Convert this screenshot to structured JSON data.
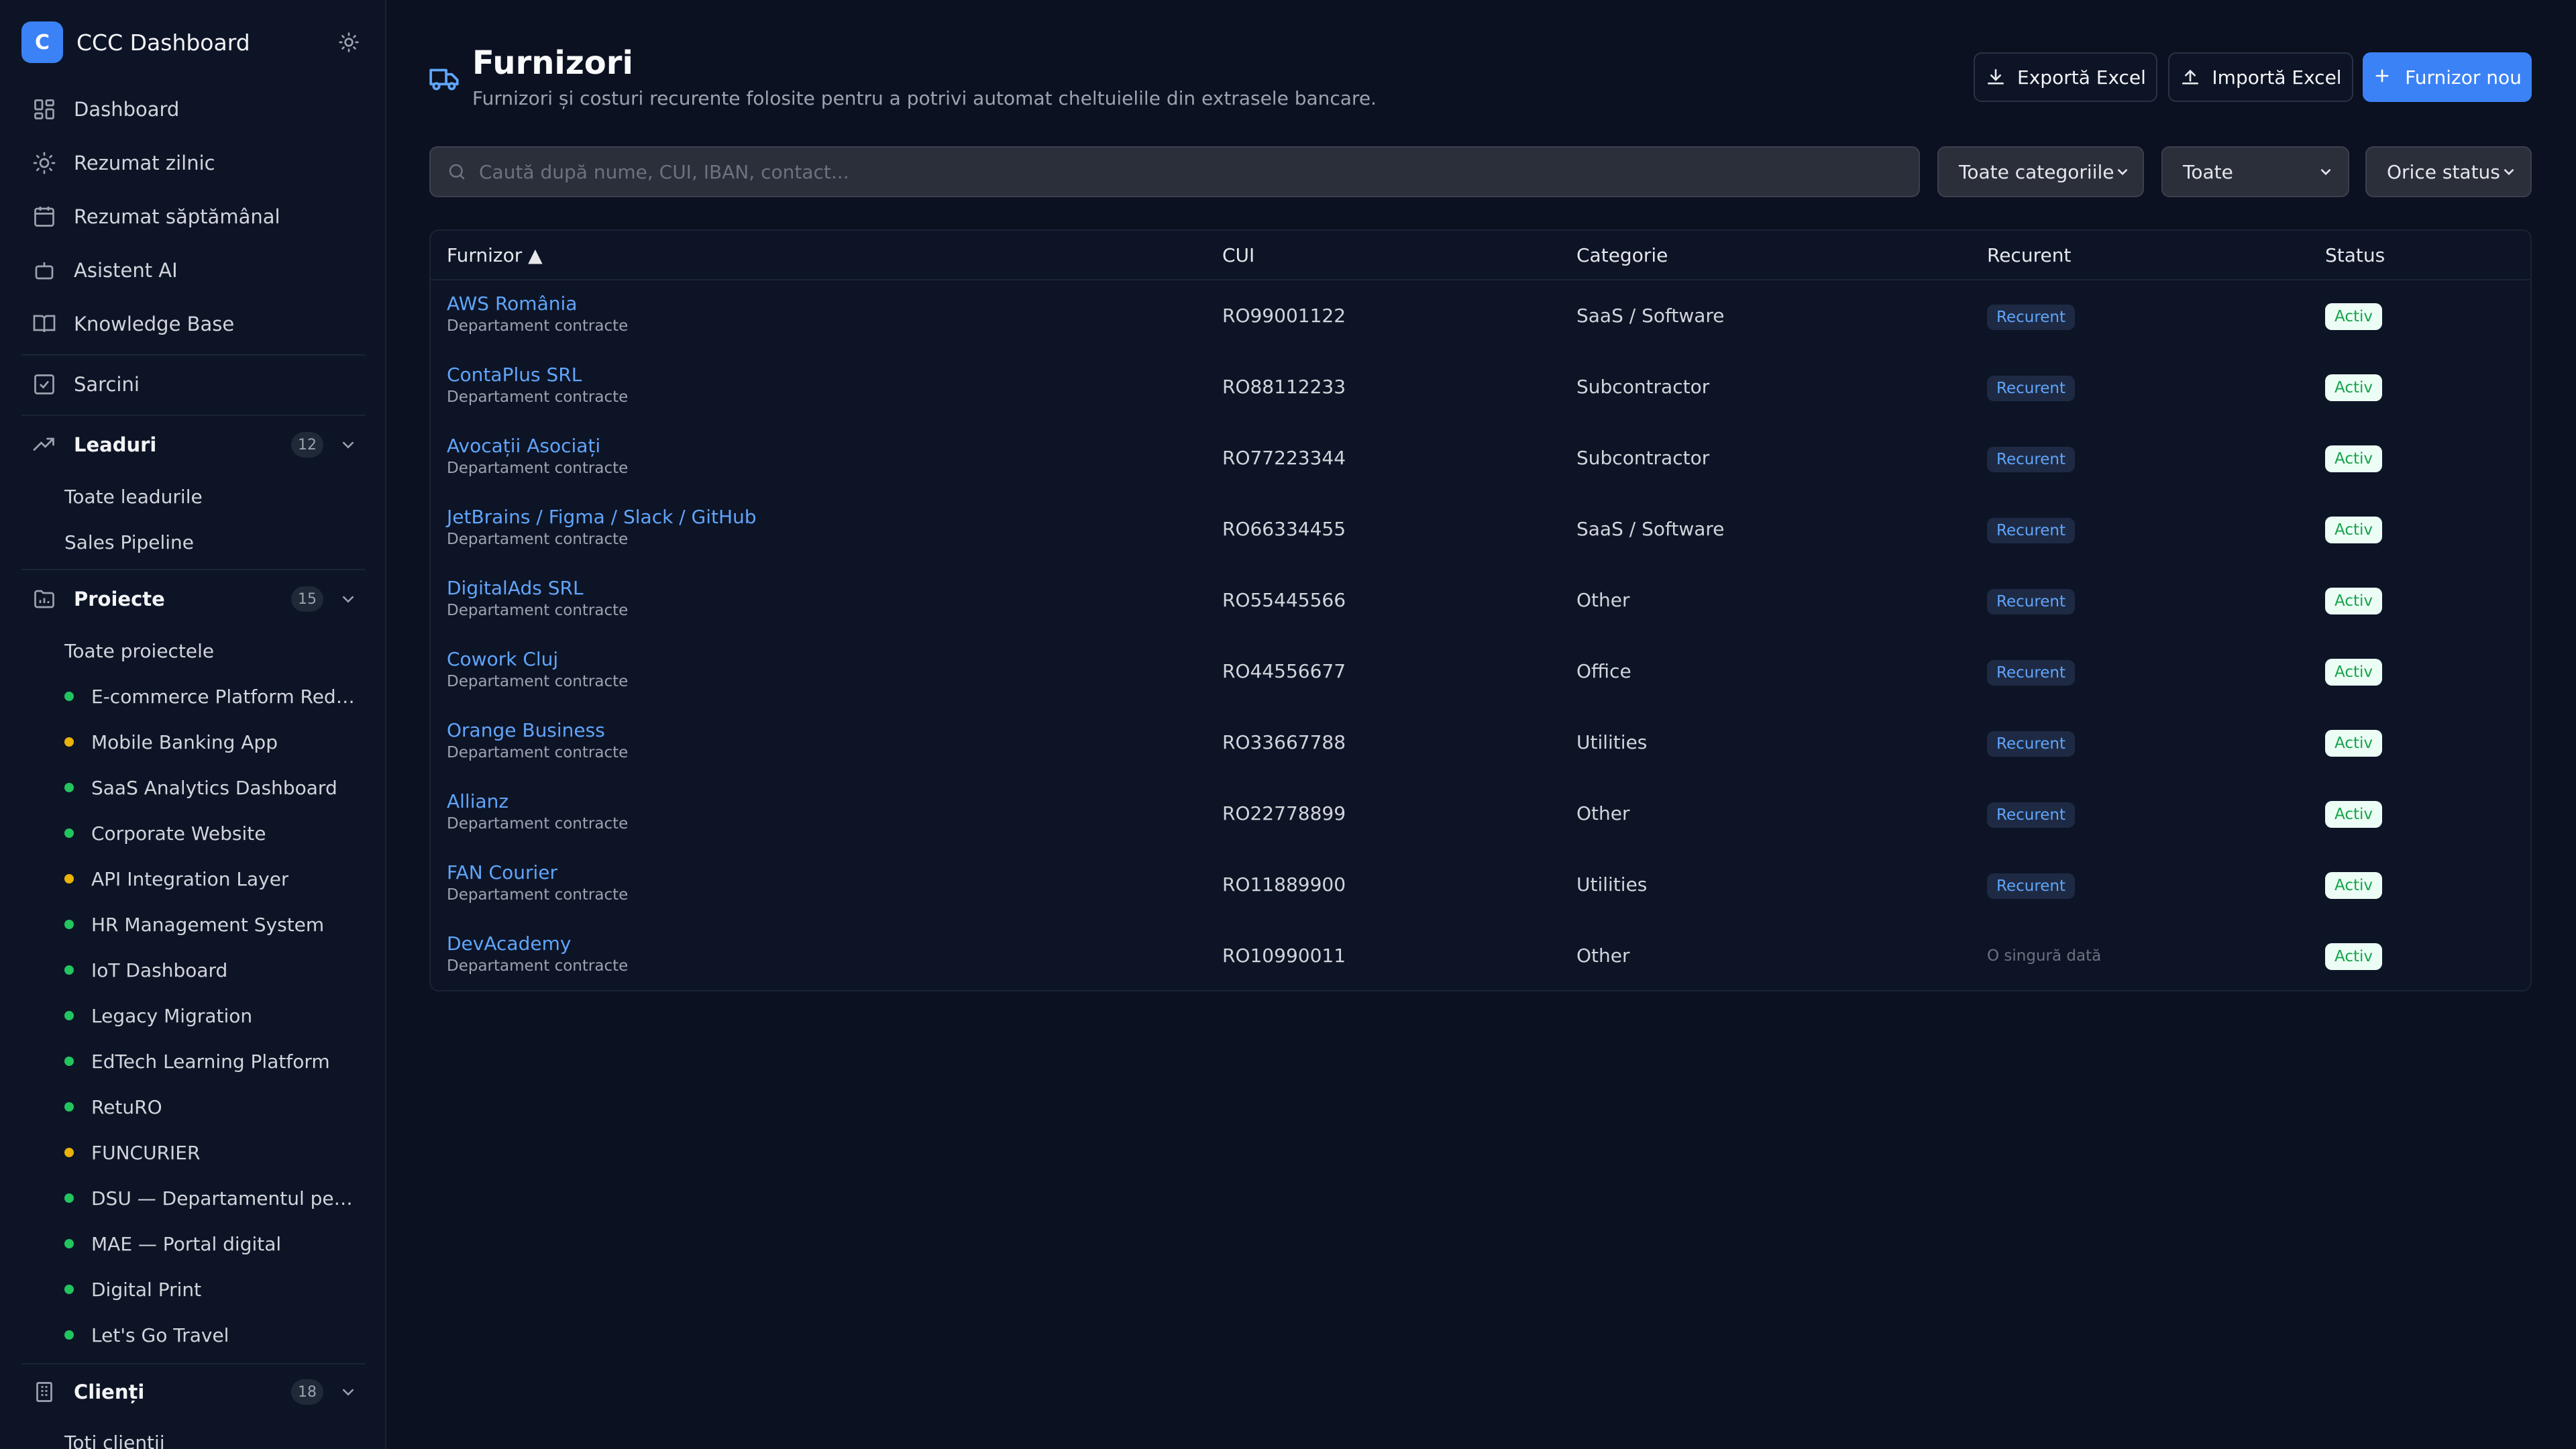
{
  "colors": {
    "accent": "#3b82f6",
    "link": "#60a5fa",
    "dot_green": "#22c55e",
    "dot_yellow": "#eab308",
    "active_badge_bg": "#ecfdf5",
    "active_badge_text": "#16a34a"
  },
  "brand": {
    "logo_letter": "C",
    "title": "CCC Dashboard",
    "theme_icon": "sun-icon"
  },
  "nav": {
    "dashboard": "Dashboard",
    "daily": "Rezumat zilnic",
    "weekly": "Rezumat săptămânal",
    "ai": "Asistent AI",
    "kb": "Knowledge Base",
    "tasks": "Sarcini",
    "leads": {
      "label": "Leaduri",
      "count": "12",
      "items": [
        "Toate leadurile",
        "Sales Pipeline"
      ]
    },
    "projects": {
      "label": "Proiecte",
      "count": "15",
      "all": "Toate proiectele",
      "items": [
        {
          "name": "E-commerce Platform Rede...",
          "status": "green"
        },
        {
          "name": "Mobile Banking App",
          "status": "yellow"
        },
        {
          "name": "SaaS Analytics Dashboard",
          "status": "green"
        },
        {
          "name": "Corporate Website",
          "status": "green"
        },
        {
          "name": "API Integration Layer",
          "status": "yellow"
        },
        {
          "name": "HR Management System",
          "status": "green"
        },
        {
          "name": "IoT Dashboard",
          "status": "green"
        },
        {
          "name": "Legacy Migration",
          "status": "green"
        },
        {
          "name": "EdTech Learning Platform",
          "status": "green"
        },
        {
          "name": "RetuRO",
          "status": "green"
        },
        {
          "name": "FUNCURIER",
          "status": "yellow"
        },
        {
          "name": "DSU — Departamentul pent...",
          "status": "green"
        },
        {
          "name": "MAE — Portal digital",
          "status": "green"
        },
        {
          "name": "Digital Print",
          "status": "green"
        },
        {
          "name": "Let's Go Travel",
          "status": "green"
        }
      ]
    },
    "clients": {
      "label": "Clienți",
      "count": "18",
      "items": [
        "Toți clienții"
      ]
    }
  },
  "page": {
    "title": "Furnizori",
    "subtitle": "Furnizori și costuri recurente folosite pentru a potrivi automat cheltuielile din extrasele bancare."
  },
  "toolbar": {
    "export": "Exportă Excel",
    "import": "Importă Excel",
    "new": "Furnizor nou"
  },
  "filters": {
    "search_placeholder": "Caută după nume, CUI, IBAN, contact...",
    "category": "Toate categoriile",
    "recurring": "Toate",
    "status": "Orice status"
  },
  "table": {
    "headers": {
      "supplier": "Furnizor ▲",
      "cui": "CUI",
      "category": "Categorie",
      "recurring": "Recurent",
      "status": "Status"
    },
    "rows": [
      {
        "name": "AWS România",
        "dept": "Departament contracte",
        "cui": "RO99001122",
        "category": "SaaS / Software",
        "recurring": "Recurent",
        "recurring_flag": true,
        "status": "Activ"
      },
      {
        "name": "ContaPlus SRL",
        "dept": "Departament contracte",
        "cui": "RO88112233",
        "category": "Subcontractor",
        "recurring": "Recurent",
        "recurring_flag": true,
        "status": "Activ"
      },
      {
        "name": "Avocații Asociați",
        "dept": "Departament contracte",
        "cui": "RO77223344",
        "category": "Subcontractor",
        "recurring": "Recurent",
        "recurring_flag": true,
        "status": "Activ"
      },
      {
        "name": "JetBrains / Figma / Slack / GitHub",
        "dept": "Departament contracte",
        "cui": "RO66334455",
        "category": "SaaS / Software",
        "recurring": "Recurent",
        "recurring_flag": true,
        "status": "Activ"
      },
      {
        "name": "DigitalAds SRL",
        "dept": "Departament contracte",
        "cui": "RO55445566",
        "category": "Other",
        "recurring": "Recurent",
        "recurring_flag": true,
        "status": "Activ"
      },
      {
        "name": "Cowork Cluj",
        "dept": "Departament contracte",
        "cui": "RO44556677",
        "category": "Office",
        "recurring": "Recurent",
        "recurring_flag": true,
        "status": "Activ"
      },
      {
        "name": "Orange Business",
        "dept": "Departament contracte",
        "cui": "RO33667788",
        "category": "Utilities",
        "recurring": "Recurent",
        "recurring_flag": true,
        "status": "Activ"
      },
      {
        "name": "Allianz",
        "dept": "Departament contracte",
        "cui": "RO22778899",
        "category": "Other",
        "recurring": "Recurent",
        "recurring_flag": true,
        "status": "Activ"
      },
      {
        "name": "FAN Courier",
        "dept": "Departament contracte",
        "cui": "RO11889900",
        "category": "Utilities",
        "recurring": "Recurent",
        "recurring_flag": true,
        "status": "Activ"
      },
      {
        "name": "DevAcademy",
        "dept": "Departament contracte",
        "cui": "RO10990011",
        "category": "Other",
        "recurring": "O singură dată",
        "recurring_flag": false,
        "status": "Activ"
      }
    ]
  }
}
